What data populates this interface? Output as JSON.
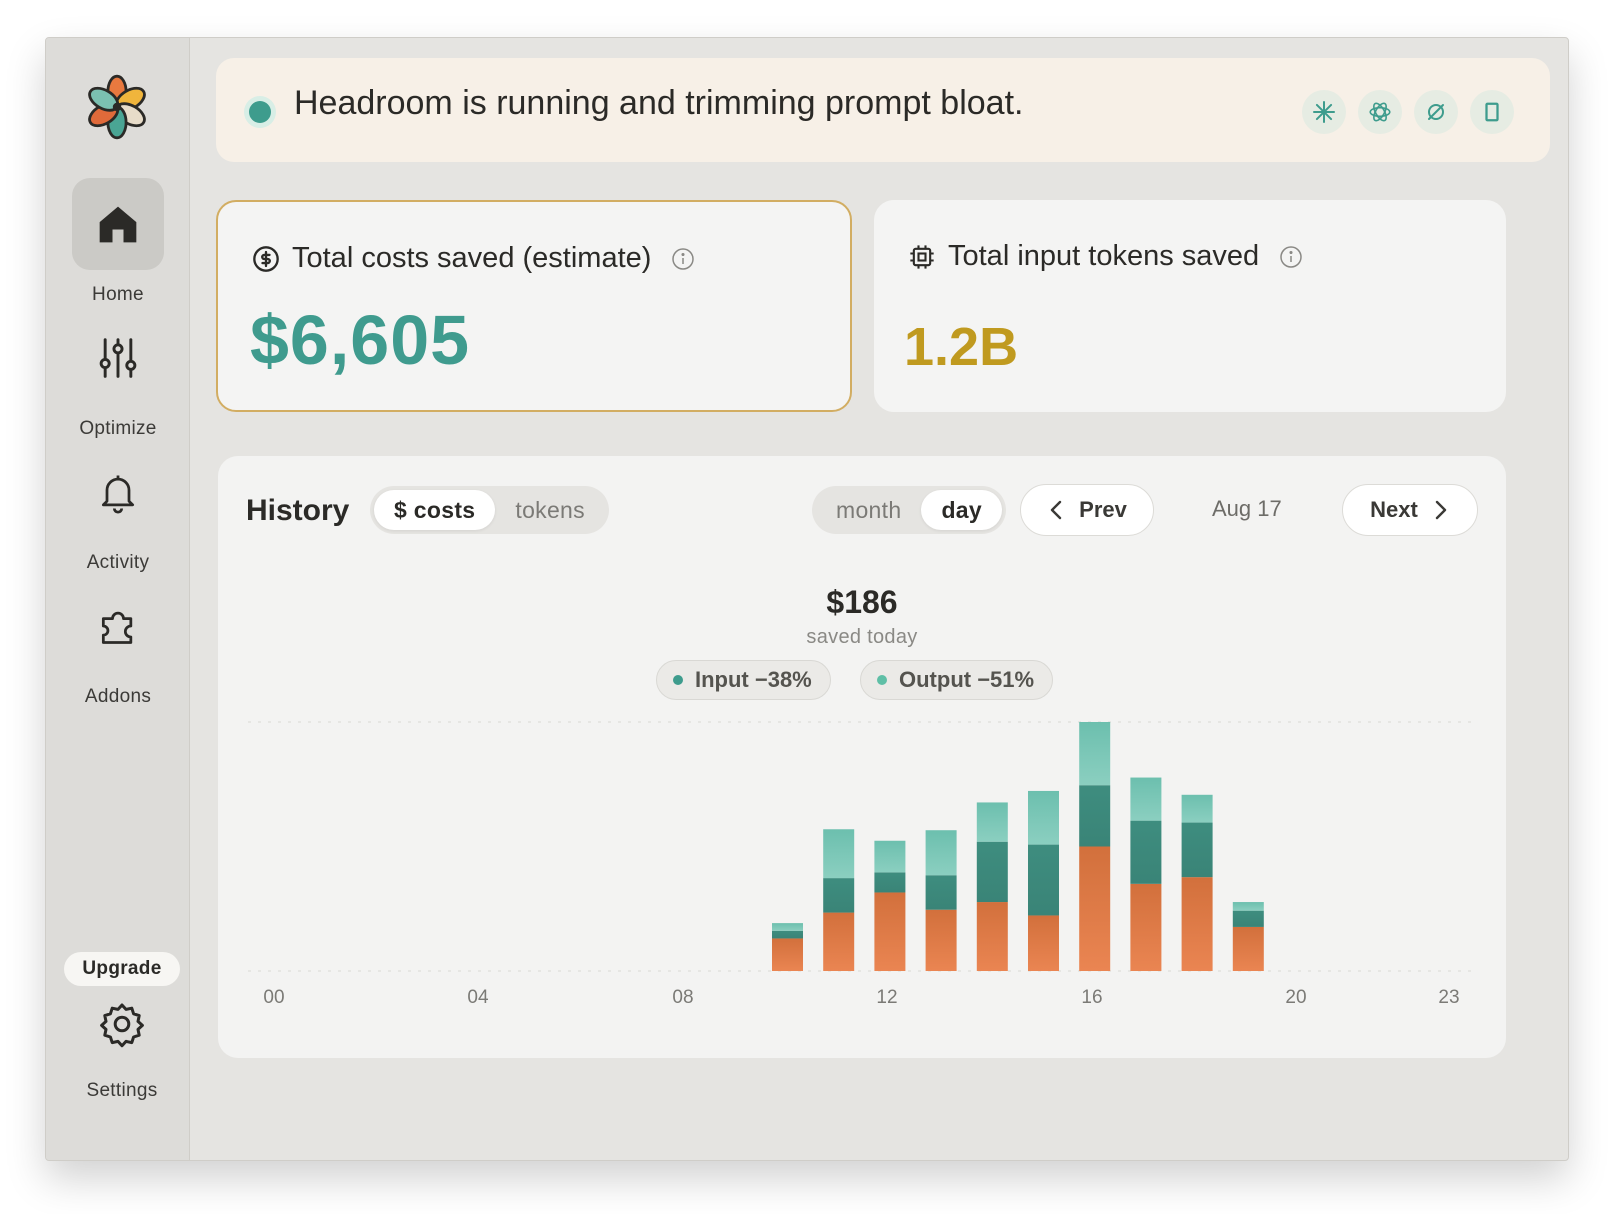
{
  "banner": {
    "status_text": "Headroom is running and trimming prompt bloat.",
    "providers": [
      {
        "icon": "claude-icon"
      },
      {
        "icon": "openai-icon"
      },
      {
        "icon": "sync-icon"
      },
      {
        "icon": "gemini-icon"
      }
    ]
  },
  "sidebar": {
    "items": [
      {
        "label": "Home",
        "icon": "home-icon",
        "active": true
      },
      {
        "label": "Optimize",
        "icon": "sliders-icon",
        "active": false
      },
      {
        "label": "Activity",
        "icon": "bell-icon",
        "active": false
      },
      {
        "label": "Addons",
        "icon": "puzzle-icon",
        "active": false
      }
    ],
    "upgrade_label": "Upgrade",
    "settings_label": "Settings"
  },
  "cards": {
    "costs": {
      "title": "Total costs saved (estimate)",
      "value": "$6,605"
    },
    "tokens": {
      "title": "Total input tokens saved",
      "value": "1.2B"
    }
  },
  "history": {
    "title": "History",
    "metric_toggle": {
      "options": [
        "$ costs",
        "tokens"
      ],
      "selected": "$ costs"
    },
    "range_toggle": {
      "options": [
        "month",
        "day"
      ],
      "selected": "day"
    },
    "prev_label": "Prev",
    "next_label": "Next",
    "date_label": "Aug 17",
    "summary_value": "$186",
    "summary_sub": "saved today",
    "legend": [
      {
        "label": "Input −38%",
        "color": "#3e9c8d"
      },
      {
        "label": "Output −51%",
        "color": "#5fbfa6"
      }
    ]
  },
  "colors": {
    "accent_teal": "#3f9b8e",
    "accent_gold": "#c09a1f",
    "bar_orange": "#e07a45",
    "bar_teal_dark": "#3e8d7f",
    "bar_teal_light": "#7ec9b8"
  },
  "chart_data": {
    "type": "bar",
    "stacked": true,
    "x_tick_labels": [
      "00",
      "04",
      "08",
      "12",
      "16",
      "20",
      "23"
    ],
    "categories": [
      "00",
      "01",
      "02",
      "03",
      "04",
      "05",
      "06",
      "07",
      "08",
      "09",
      "10",
      "11",
      "12",
      "13",
      "14",
      "15",
      "16",
      "17",
      "18",
      "19",
      "20",
      "21",
      "22",
      "23"
    ],
    "series": [
      {
        "name": "",
        "color": "#e07a45",
        "values": [
          0,
          0,
          0,
          0,
          0,
          0,
          0,
          0,
          0,
          0,
          3.4,
          6.1,
          8.2,
          6.4,
          7.2,
          5.8,
          13.0,
          9.1,
          9.8,
          4.6,
          0,
          0,
          0,
          0
        ]
      },
      {
        "name": "",
        "color": "#3e8d7f",
        "values": [
          0,
          0,
          0,
          0,
          0,
          0,
          0,
          0,
          0,
          0,
          0.8,
          3.6,
          2.1,
          3.6,
          6.3,
          7.4,
          6.4,
          6.6,
          5.7,
          1.7,
          0,
          0,
          0,
          0
        ]
      },
      {
        "name": "",
        "color": "#7ec9b8",
        "values": [
          0,
          0,
          0,
          0,
          0,
          0,
          0,
          0,
          0,
          0,
          0.8,
          5.1,
          3.3,
          4.7,
          4.1,
          5.6,
          6.6,
          4.5,
          2.9,
          0.9,
          0,
          0,
          0,
          0
        ]
      }
    ],
    "ylim": [
      0,
      26
    ],
    "grid": "dashed top and baseline"
  }
}
